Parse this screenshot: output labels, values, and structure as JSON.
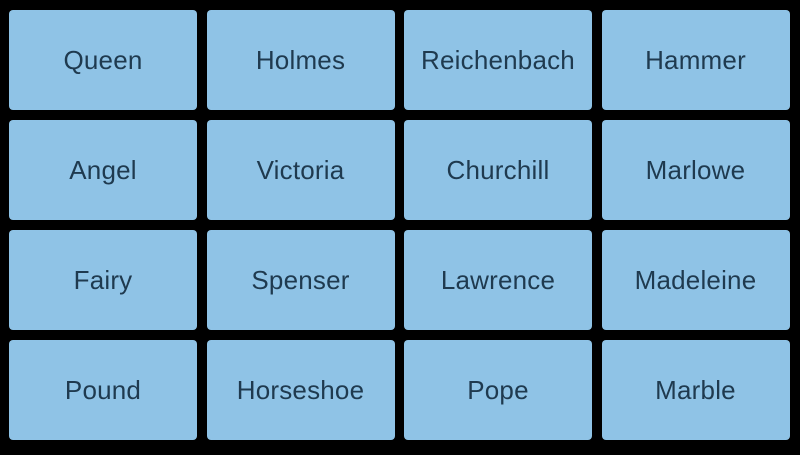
{
  "colors": {
    "background": "#000000",
    "tile": "#8fc3e6",
    "tile_text": "#1f3a4f"
  },
  "tiles": [
    "Queen",
    "Holmes",
    "Reichenbach",
    "Hammer",
    "Angel",
    "Victoria",
    "Churchill",
    "Marlowe",
    "Fairy",
    "Spenser",
    "Lawrence",
    "Madeleine",
    "Pound",
    "Horseshoe",
    "Pope",
    "Marble"
  ]
}
